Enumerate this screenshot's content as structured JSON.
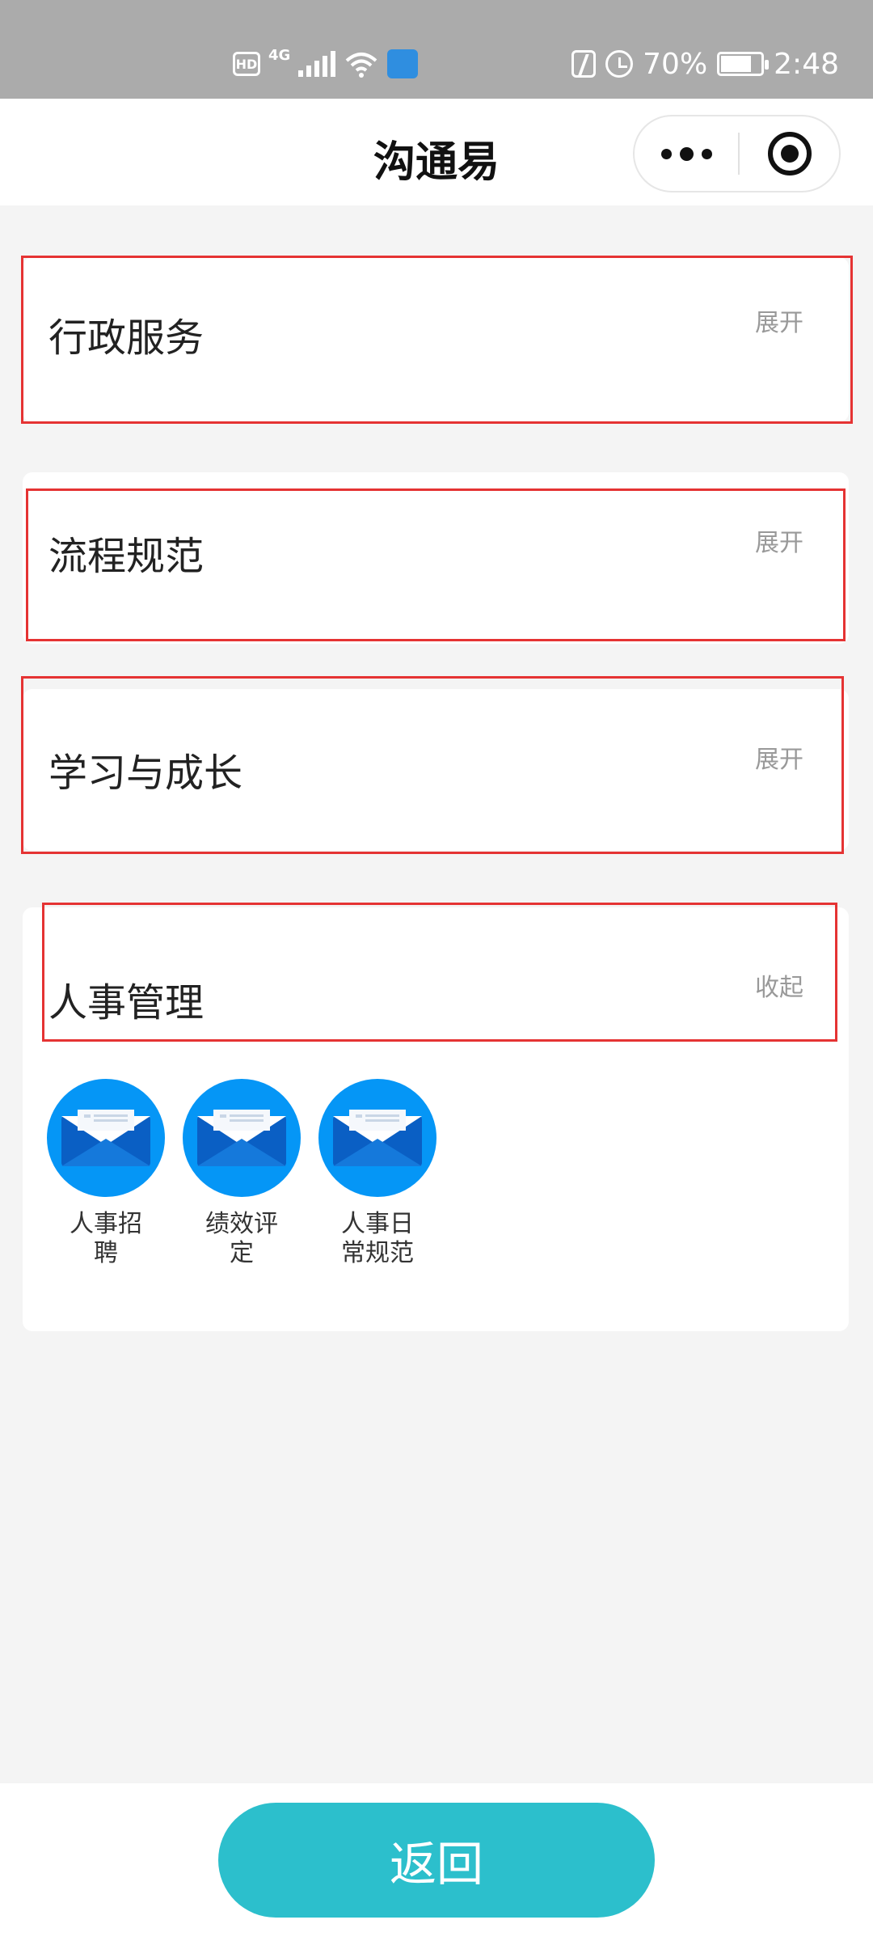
{
  "status_bar": {
    "hd_label": "HD",
    "network_label": "4G",
    "nfc_symbol": "N",
    "battery_percent": "70%",
    "battery_level": 0.7,
    "time": "2:48"
  },
  "nav": {
    "title": "沟通易"
  },
  "sections": [
    {
      "title": "行政服务",
      "toggle": "展开"
    },
    {
      "title": "流程规范",
      "toggle": "展开"
    },
    {
      "title": "学习与成长",
      "toggle": "展开"
    },
    {
      "title": "人事管理",
      "toggle": "收起",
      "items": [
        {
          "label": "人事招聘",
          "icon": "envelope-icon"
        },
        {
          "label": "绩效评定",
          "icon": "envelope-icon"
        },
        {
          "label": "人事日常规范",
          "icon": "envelope-icon"
        }
      ]
    }
  ],
  "footer": {
    "back_label": "返回"
  },
  "colors": {
    "accent": "#2cbfcc",
    "icon_bg": "#0596f6",
    "highlight": "#e53333"
  }
}
